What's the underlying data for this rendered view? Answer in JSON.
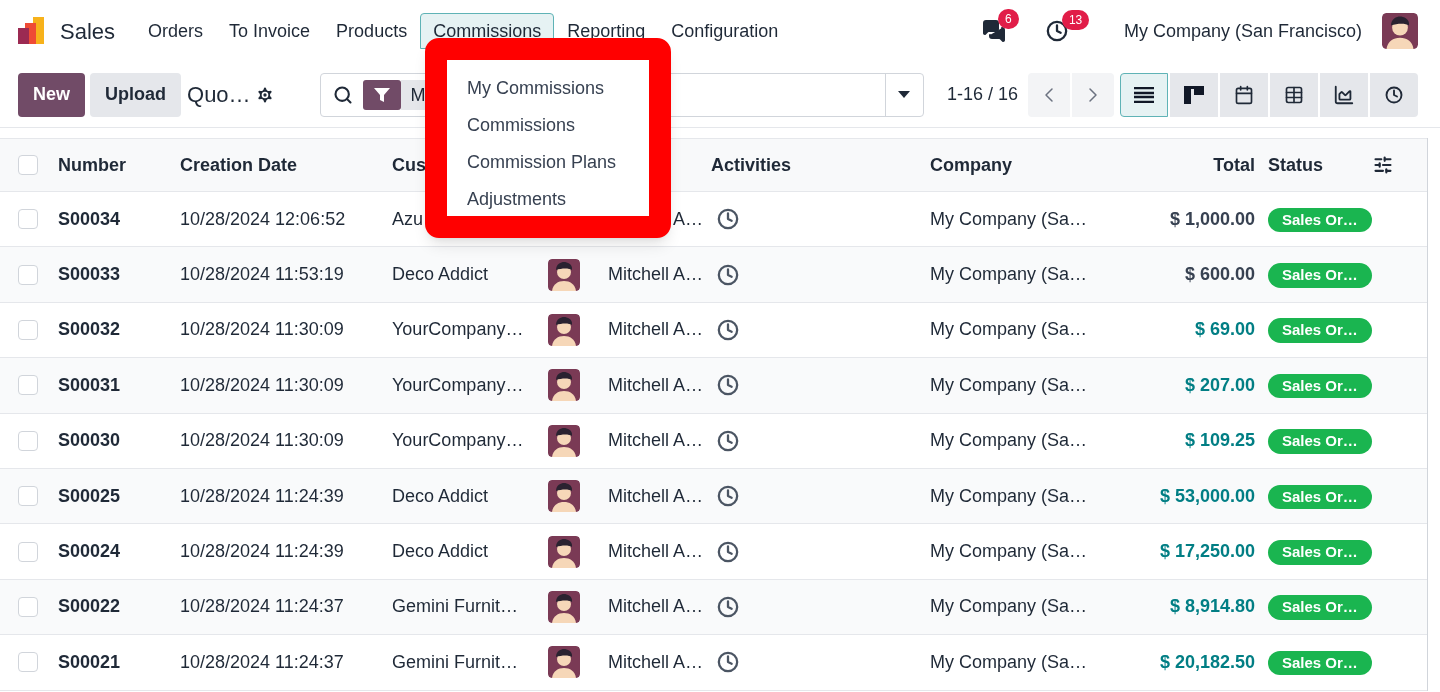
{
  "app": {
    "name": "Sales"
  },
  "nav": [
    {
      "label": "Orders",
      "selected": false
    },
    {
      "label": "To Invoice",
      "selected": false
    },
    {
      "label": "Products",
      "selected": false
    },
    {
      "label": "Commissions",
      "selected": true
    },
    {
      "label": "Reporting",
      "selected": false
    },
    {
      "label": "Configuration",
      "selected": false
    }
  ],
  "systray": {
    "messages_count": "6",
    "activities_count": "13",
    "company": "My Company (San Francisco)"
  },
  "control_panel": {
    "new_button": "New",
    "upload_button": "Upload",
    "breadcrumb": "Quo…",
    "search": {
      "facet": "M"
    },
    "pager": "1-16 / 16",
    "views": [
      {
        "kind": "list",
        "selected": true
      },
      {
        "kind": "kanban",
        "selected": false
      },
      {
        "kind": "calendar",
        "selected": false
      },
      {
        "kind": "pivot",
        "selected": false
      },
      {
        "kind": "graph",
        "selected": false
      },
      {
        "kind": "activity",
        "selected": false
      }
    ]
  },
  "dropdown": {
    "items": [
      "My Commissions",
      "Commissions",
      "Commission Plans",
      "Adjustments"
    ]
  },
  "table": {
    "select_all_checked": false,
    "columns": [
      "Number",
      "Creation Date",
      "Cus",
      "Activities",
      "Company",
      "Total",
      "Status"
    ],
    "rows": [
      {
        "checked": false,
        "number": "S00034",
        "date": "10/28/2024 12:06:52",
        "customer": "Azu",
        "salesperson": "A…",
        "company": "My Company (Sa…",
        "total": "$ 1,000.00",
        "color": "#374151",
        "status": "Sales Or…"
      },
      {
        "checked": false,
        "number": "S00033",
        "date": "10/28/2024 11:53:19",
        "customer": "Deco Addict",
        "salesperson": "Mitchell A…",
        "company": "My Company (Sa…",
        "total": "$ 600.00",
        "color": "#374151",
        "status": "Sales Or…"
      },
      {
        "checked": false,
        "number": "S00032",
        "date": "10/28/2024 11:30:09",
        "customer": "YourCompany…",
        "salesperson": "Mitchell A…",
        "company": "My Company (Sa…",
        "total": "$ 69.00",
        "color": "#017e84",
        "status": "Sales Or…"
      },
      {
        "checked": false,
        "number": "S00031",
        "date": "10/28/2024 11:30:09",
        "customer": "YourCompany…",
        "salesperson": "Mitchell A…",
        "company": "My Company (Sa…",
        "total": "$ 207.00",
        "color": "#017e84",
        "status": "Sales Or…"
      },
      {
        "checked": false,
        "number": "S00030",
        "date": "10/28/2024 11:30:09",
        "customer": "YourCompany…",
        "salesperson": "Mitchell A…",
        "company": "My Company (Sa…",
        "total": "$ 109.25",
        "color": "#017e84",
        "status": "Sales Or…"
      },
      {
        "checked": false,
        "number": "S00025",
        "date": "10/28/2024 11:24:39",
        "customer": "Deco Addict",
        "salesperson": "Mitchell A…",
        "company": "My Company (Sa…",
        "total": "$ 53,000.00",
        "color": "#017e84",
        "status": "Sales Or…"
      },
      {
        "checked": false,
        "number": "S00024",
        "date": "10/28/2024 11:24:39",
        "customer": "Deco Addict",
        "salesperson": "Mitchell A…",
        "company": "My Company (Sa…",
        "total": "$ 17,250.00",
        "color": "#017e84",
        "status": "Sales Or…"
      },
      {
        "checked": false,
        "number": "S00022",
        "date": "10/28/2024 11:24:37",
        "customer": "Gemini Furnit…",
        "salesperson": "Mitchell A…",
        "company": "My Company (Sa…",
        "total": "$ 8,914.80",
        "color": "#017e84",
        "status": "Sales Or…"
      },
      {
        "checked": false,
        "number": "S00021",
        "date": "10/28/2024 11:24:37",
        "customer": "Gemini Furnit…",
        "salesperson": "Mitchell A…",
        "company": "My Company (Sa…",
        "total": "$ 20,182.50",
        "color": "#017e84",
        "status": "Sales Or…"
      }
    ]
  }
}
